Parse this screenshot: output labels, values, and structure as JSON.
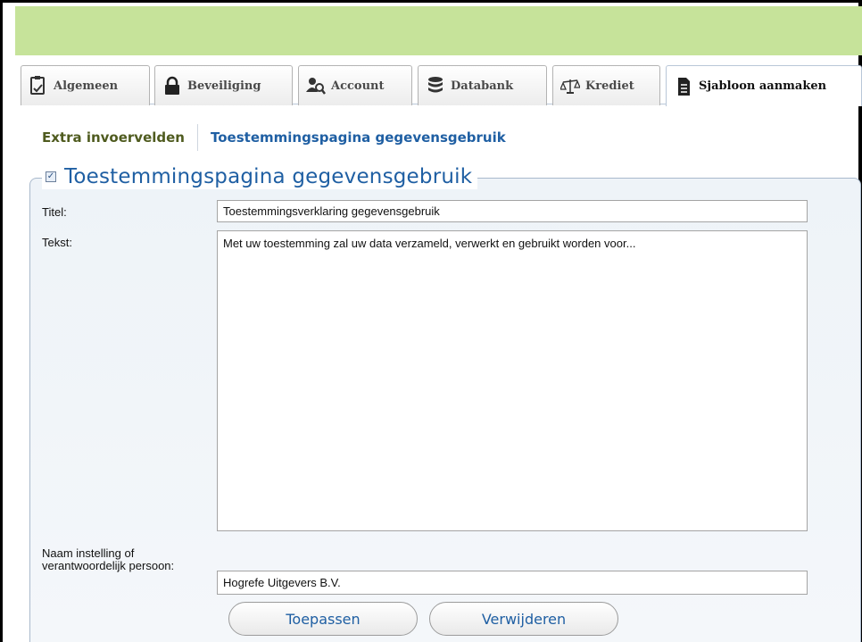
{
  "tabs": [
    {
      "label": "Algemeen",
      "icon": "clipboard-icon"
    },
    {
      "label": "Beveiliging",
      "icon": "lock-icon"
    },
    {
      "label": "Account",
      "icon": "user-search-icon"
    },
    {
      "label": "Databank",
      "icon": "database-icon"
    },
    {
      "label": "Krediet",
      "icon": "scales-icon"
    },
    {
      "label": "Sjabloon aanmaken",
      "icon": "document-icon",
      "active": true
    }
  ],
  "subnav": {
    "item1": "Extra invoervelden",
    "item2": "Toestemmingspagina gegevensgebruik"
  },
  "section": {
    "title": "Toestemmingspagina gegevensgebruik",
    "checked": true
  },
  "form": {
    "title_label": "Titel:",
    "title_value": "Toestemmingsverklaring gegevensgebruik",
    "text_label": "Tekst:",
    "text_value": "Met uw toestemming zal uw data verzameld, verwerkt en gebruikt worden voor...",
    "name_label": "Naam instelling of verantwoordelijk persoon:",
    "name_value": "Hogrefe Uitgevers B.V."
  },
  "buttons": {
    "apply": "Toepassen",
    "delete": "Verwijderen"
  },
  "colors": {
    "topbar": "#c6e39a",
    "link_blue": "#1f5fa3",
    "olive": "#4f5b1f"
  }
}
